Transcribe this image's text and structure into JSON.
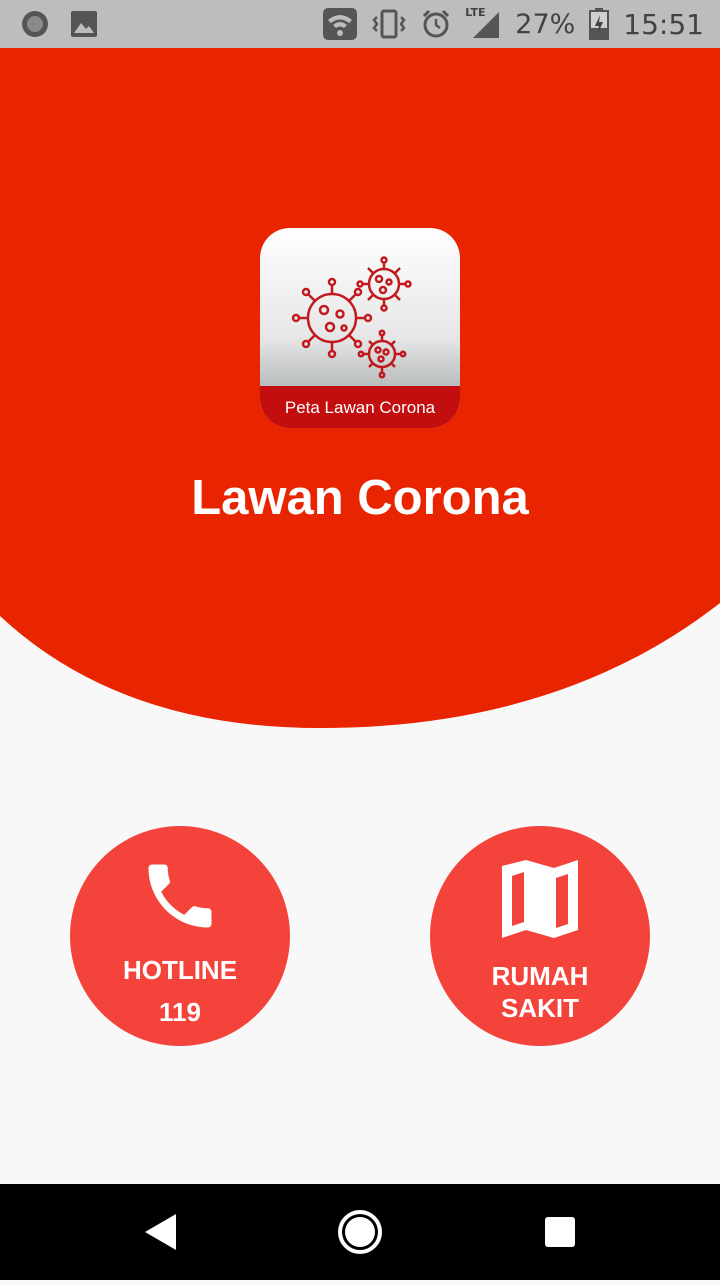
{
  "status_bar": {
    "battery_percent": "27%",
    "time": "15:51",
    "network_label": "LTE",
    "icons": [
      "notification-circle-icon",
      "image-icon",
      "wifi-icon",
      "vibrate-icon",
      "alarm-icon",
      "lte-signal-icon",
      "battery-charging-icon"
    ]
  },
  "colors": {
    "header_red": "#e92400",
    "button_red": "#f4433a",
    "logo_band": "#c20e0e",
    "background": "#f8f8f8"
  },
  "app": {
    "logo_text": "Peta Lawan Corona",
    "title": "Lawan Corona"
  },
  "buttons": {
    "hotline": {
      "label": "HOTLINE",
      "number": "119",
      "icon": "phone-icon"
    },
    "hospital": {
      "line1": "RUMAH",
      "line2": "SAKIT",
      "icon": "map-icon"
    }
  },
  "nav": {
    "icons": [
      "back-icon",
      "home-icon",
      "recents-icon"
    ]
  }
}
